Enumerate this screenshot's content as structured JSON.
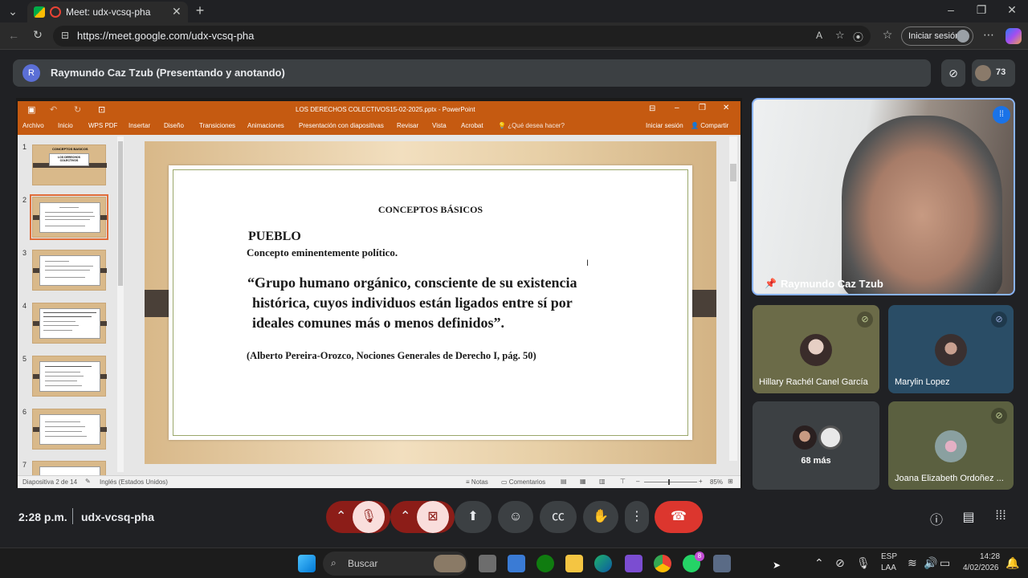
{
  "browser": {
    "tab_title": "Meet: udx-vcsq-pha",
    "url": "https://meet.google.com/udx-vcsq-pha",
    "signin_label": "Iniciar sesión"
  },
  "meet": {
    "presenter_label": "Raymundo Caz Tzub (Presentando y anotando)",
    "presenter_initial": "R",
    "participant_count": "73",
    "time": "2:28 p.m.",
    "meeting_code": "udx-vcsq-pha"
  },
  "ppt": {
    "window_title": "LOS DERECHOS COLECTIVOS15-02-2025.pptx - PowerPoint",
    "ribbon": [
      "Archivo",
      "Inicio",
      "WPS PDF",
      "Insertar",
      "Diseño",
      "Transiciones",
      "Animaciones",
      "Presentación con diapositivas",
      "Revisar",
      "Vista",
      "Acrobat"
    ],
    "tell_me": "¿Qué desea hacer?",
    "signin": "Iniciar sesión",
    "share": "Compartir",
    "status_slide": "Diapositiva 2 de 14",
    "status_lang": "Inglés (Estados Unidos)",
    "notes": "Notas",
    "comments": "Comentarios",
    "zoom": "85%",
    "thumb_numbers": [
      "1",
      "2",
      "3",
      "4",
      "5",
      "6",
      "7"
    ],
    "thumb1_title": "CONCEPTOS BASICOS",
    "thumb1_sub": "LOS DERECHOS COLECTIVOS"
  },
  "slide": {
    "heading": "CONCEPTOS BÁSICOS",
    "term": "PUEBLO",
    "subtitle": "Concepto eminentemente político.",
    "quote_line1": "“Grupo humano orgánico, consciente de su existencia",
    "quote_line2": "histórica, cuyos individuos están ligados entre sí por",
    "quote_line3": "ideales comunes más o menos definidos”.",
    "citation": "(Alberto Pereira-Orozco, Nociones Generales de Derecho I, pág. 50)"
  },
  "participants": {
    "main": "Raymundo Caz Tzub",
    "p1": "Hillary Rachél Canel García",
    "p2": "Marylin Lopez",
    "more": "68 más",
    "p4": "Joana Elizabeth Ordoñez ..."
  },
  "taskbar": {
    "search": "Buscar",
    "lang1": "ESP",
    "lang2": "LAA",
    "clock_time": "14:28",
    "clock_date": "4/02/2026",
    "whatsapp_badge": "8"
  },
  "colors": {
    "ppt_orange": "#c55a11",
    "meet_red": "#ea4335",
    "mic_off_bg": "#f9dedc"
  }
}
